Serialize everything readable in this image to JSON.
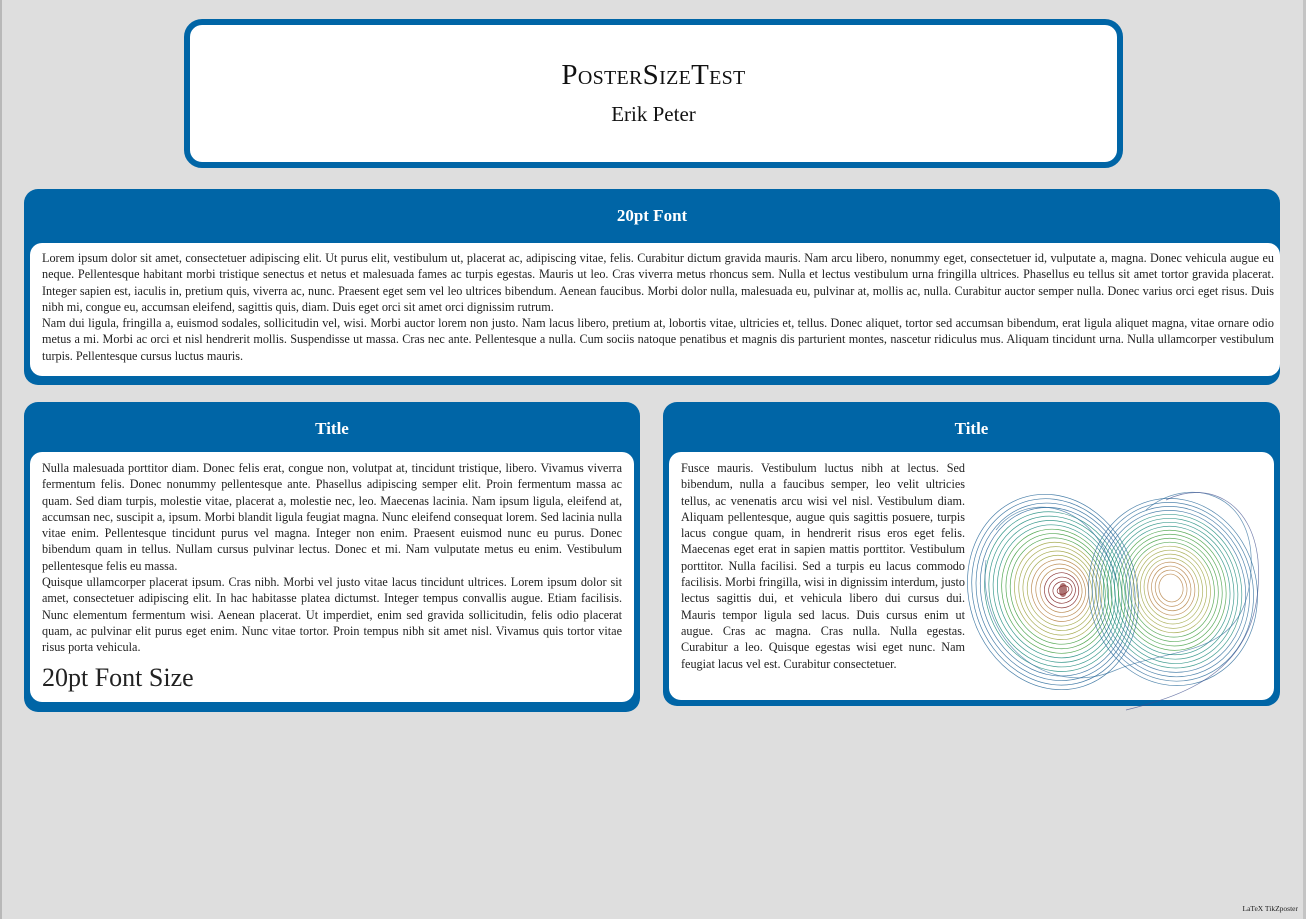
{
  "poster": {
    "title": "PosterSizeTest",
    "author": "Erik Peter"
  },
  "blocks": {
    "top": {
      "title": "20pt Font",
      "paragraphs": [
        "Lorem ipsum dolor sit amet, consectetuer adipiscing elit. Ut purus elit, vestibulum ut, placerat ac, adipiscing vitae, felis. Curabitur dictum gravida mauris. Nam arcu libero, nonummy eget, consectetuer id, vulputate a, magna. Donec vehicula augue eu neque. Pellentesque habitant morbi tristique senectus et netus et malesuada fames ac turpis egestas. Mauris ut leo. Cras viverra metus rhoncus sem. Nulla et lectus vestibulum urna fringilla ultrices. Phasellus eu tellus sit amet tortor gravida placerat. Integer sapien est, iaculis in, pretium quis, viverra ac, nunc. Praesent eget sem vel leo ultrices bibendum. Aenean faucibus. Morbi dolor nulla, malesuada eu, pulvinar at, mollis ac, nulla. Curabitur auctor semper nulla. Donec varius orci eget risus. Duis nibh mi, congue eu, accumsan eleifend, sagittis quis, diam. Duis eget orci sit amet orci dignissim rutrum.",
        "Nam dui ligula, fringilla a, euismod sodales, sollicitudin vel, wisi. Morbi auctor lorem non justo. Nam lacus libero, pretium at, lobortis vitae, ultricies et, tellus. Donec aliquet, tortor sed accumsan bibendum, erat ligula aliquet magna, vitae ornare odio metus a mi. Morbi ac orci et nisl hendrerit mollis. Suspendisse ut massa. Cras nec ante. Pellentesque a nulla. Cum sociis natoque penatibus et magnis dis parturient montes, nascetur ridiculus mus. Aliquam tincidunt urna. Nulla ullamcorper vestibulum turpis. Pellentesque cursus luctus mauris."
      ]
    },
    "left": {
      "title": "Title",
      "paragraphs": [
        "Nulla malesuada porttitor diam. Donec felis erat, congue non, volutpat at, tincidunt tristique, libero. Vivamus viverra fermentum felis. Donec nonummy pellentesque ante. Phasellus adipiscing semper elit. Proin fermentum massa ac quam. Sed diam turpis, molestie vitae, placerat a, molestie nec, leo. Maecenas lacinia. Nam ipsum ligula, eleifend at, accumsan nec, suscipit a, ipsum. Morbi blandit ligula feugiat magna. Nunc eleifend consequat lorem. Sed lacinia nulla vitae enim. Pellentesque tincidunt purus vel magna. Integer non enim. Praesent euismod nunc eu purus. Donec bibendum quam in tellus. Nullam cursus pulvinar lectus. Donec et mi. Nam vulputate metus eu enim. Vestibulum pellentesque felis eu massa.",
        "Quisque ullamcorper placerat ipsum. Cras nibh. Morbi vel justo vitae lacus tincidunt ultrices. Lorem ipsum dolor sit amet, consectetuer adipiscing elit. In hac habitasse platea dictumst. Integer tempus convallis augue. Etiam facilisis. Nunc elementum fermentum wisi. Aenean placerat. Ut imperdiet, enim sed gravida sollicitudin, felis odio placerat quam, ac pulvinar elit purus eget enim. Nunc vitae tortor. Proin tempus nibh sit amet nisl. Vivamus quis tortor vitae risus porta vehicula."
      ],
      "large_text": "20pt Font Size"
    },
    "right": {
      "title": "Title",
      "paragraph": "Fusce mauris. Vestibulum luctus nibh at lectus. Sed bibendum, nulla a faucibus semper, leo velit ultricies tellus, ac venenatis arcu wisi vel nisl. Vestibulum diam. Aliquam pellentesque, augue quis sagittis posuere, turpis lacus congue quam, in hendrerit risus eros eget felis. Maecenas eget erat in sapien mattis porttitor. Vestibulum porttitor. Nulla facilisi. Sed a turpis eu lacus commodo facilisis. Morbi fringilla, wisi in dignissim interdum, justo lectus sagittis dui, et vehicula libero dui cursus dui. Mauris tempor ligula sed lacus. Duis cursus enim ut augue. Cras ac magna. Cras nulla. Nulla egestas. Curabitur a leo. Quisque egestas wisi eget nunc. Nam feugiat lacus vel est. Curabitur consectetuer.",
      "figure": {
        "icon": "lorenz-attractor-plot",
        "colors": [
          "#7a1a1a",
          "#b07a3a",
          "#9aa03a",
          "#3a9a3a",
          "#1a8a7a",
          "#2a6a9a"
        ]
      }
    }
  },
  "footer": {
    "text": "LaTeX TikZposter"
  },
  "colors": {
    "block_blue": "#0065a6",
    "background": "#dedede"
  }
}
